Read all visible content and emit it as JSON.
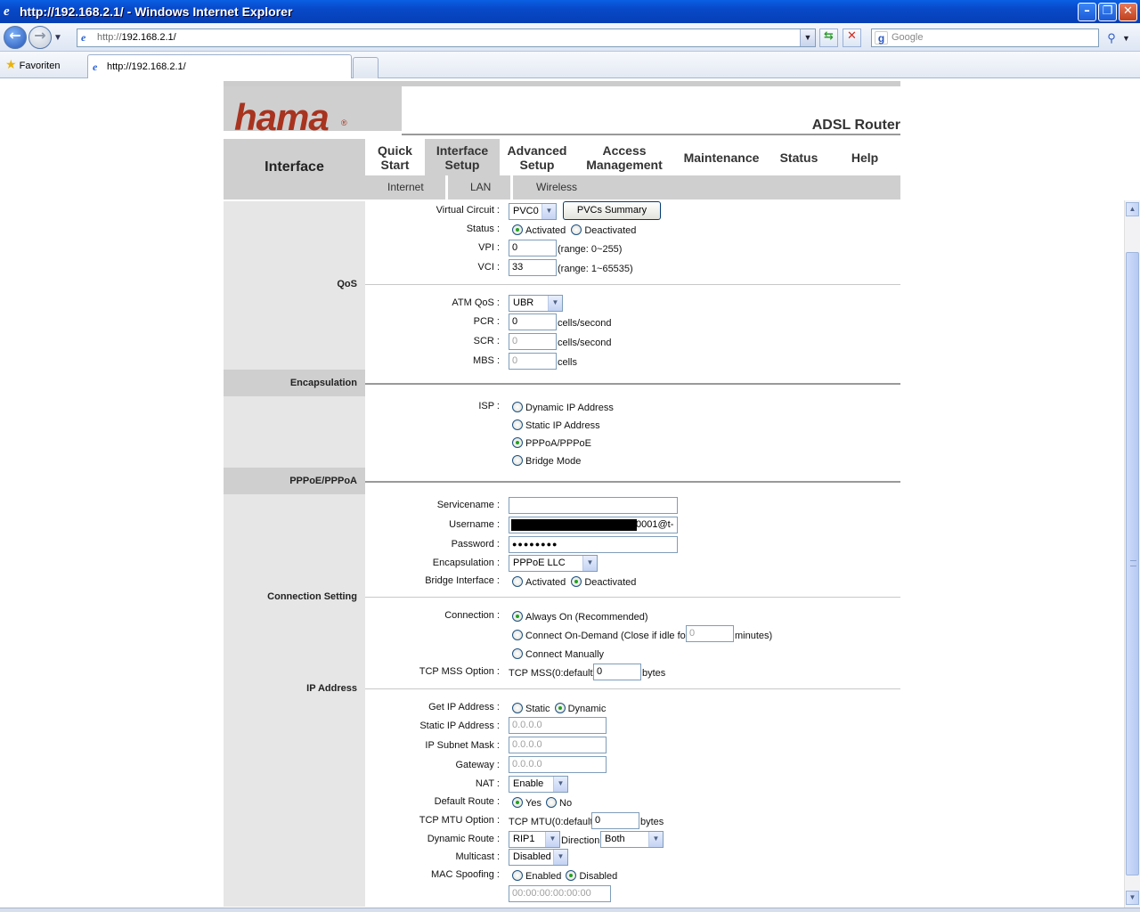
{
  "window": {
    "title": "http://192.168.2.1/ - Windows Internet Explorer"
  },
  "toolbar": {
    "address_dim": "http://",
    "address_host": "192.168.2.1/",
    "search_placeholder": "Google",
    "search_logo": "g"
  },
  "tabs": {
    "favorites": "Favoriten",
    "current": "http://192.168.2.1/"
  },
  "brand": {
    "logo": "hama",
    "reg": "®",
    "product": "ADSL Router"
  },
  "nav": {
    "section": "Interface",
    "main": [
      {
        "line1": "Quick",
        "line2": "Start"
      },
      {
        "line1": "Interface",
        "line2": "Setup"
      },
      {
        "line1": "Advanced",
        "line2": "Setup"
      },
      {
        "line1": "Access",
        "line2": "Management"
      },
      {
        "line1": "Maintenance",
        "line2": ""
      },
      {
        "line1": "Status",
        "line2": ""
      },
      {
        "line1": "Help",
        "line2": ""
      }
    ],
    "sub": [
      "Internet",
      "LAN",
      "Wireless"
    ]
  },
  "sections": {
    "qos": "QoS",
    "encapsulation": "Encapsulation",
    "pppoe": "PPPoE/PPPoA",
    "connection": "Connection Setting",
    "ip": "IP Address"
  },
  "vc": {
    "label": "Virtual Circuit :",
    "value": "PVC0",
    "summary_btn": "PVCs Summary",
    "status_label": "Status :",
    "activated": "Activated",
    "deactivated": "Deactivated",
    "vpi_label": "VPI :",
    "vpi": "0",
    "vpi_range": "(range: 0~255)",
    "vci_label": "VCI :",
    "vci": "33",
    "vci_range": "(range: 1~65535)"
  },
  "qos": {
    "atm_label": "ATM QoS :",
    "atm": "UBR",
    "pcr_label": "PCR :",
    "pcr": "0",
    "pcr_unit": "cells/second",
    "scr_label": "SCR :",
    "scr": "0",
    "scr_unit": "cells/second",
    "mbs_label": "MBS :",
    "mbs": "0",
    "mbs_unit": "cells"
  },
  "isp": {
    "label": "ISP :",
    "options": [
      "Dynamic IP Address",
      "Static IP Address",
      "PPPoA/PPPoE",
      "Bridge Mode"
    ],
    "selected": 2
  },
  "pppoe": {
    "service_label": "Servicename :",
    "service": "",
    "user_label": "Username :",
    "user_tail": "0001@t-",
    "pass_label": "Password :",
    "pass": "●●●●●●●●",
    "encap_label": "Encapsulation :",
    "encap": "PPPoE LLC",
    "bridge_label": "Bridge Interface :",
    "activated": "Activated",
    "deactivated": "Deactivated"
  },
  "connection": {
    "label": "Connection :",
    "always": "Always On (Recommended)",
    "ondemand": "Connect On-Demand (Close if idle for",
    "idle": "0",
    "minutes": "minutes)",
    "manual": "Connect Manually",
    "mss_label": "TCP MSS Option :",
    "mss_prefix": "TCP MSS(0:default)",
    "mss": "0",
    "mss_unit": "bytes"
  },
  "ip": {
    "get_label": "Get IP Address :",
    "static": "Static",
    "dynamic": "Dynamic",
    "sip_label": "Static IP Address :",
    "sip": "0.0.0.0",
    "mask_label": "IP Subnet Mask :",
    "mask": "0.0.0.0",
    "gw_label": "Gateway :",
    "gw": "0.0.0.0",
    "nat_label": "NAT :",
    "nat": "Enable",
    "route_label": "Default Route :",
    "yes": "Yes",
    "no": "No",
    "mtu_label": "TCP MTU Option :",
    "mtu_prefix": "TCP MTU(0:default)",
    "mtu": "0",
    "mtu_unit": "bytes",
    "dyn_label": "Dynamic Route :",
    "dyn": "RIP1",
    "direction": "Direction",
    "dir": "Both",
    "mc_label": "Multicast :",
    "mc": "Disabled",
    "mac_label": "MAC Spoofing :",
    "enabled": "Enabled",
    "disabled": "Disabled",
    "mac": "00:00:00:00:00:00"
  }
}
